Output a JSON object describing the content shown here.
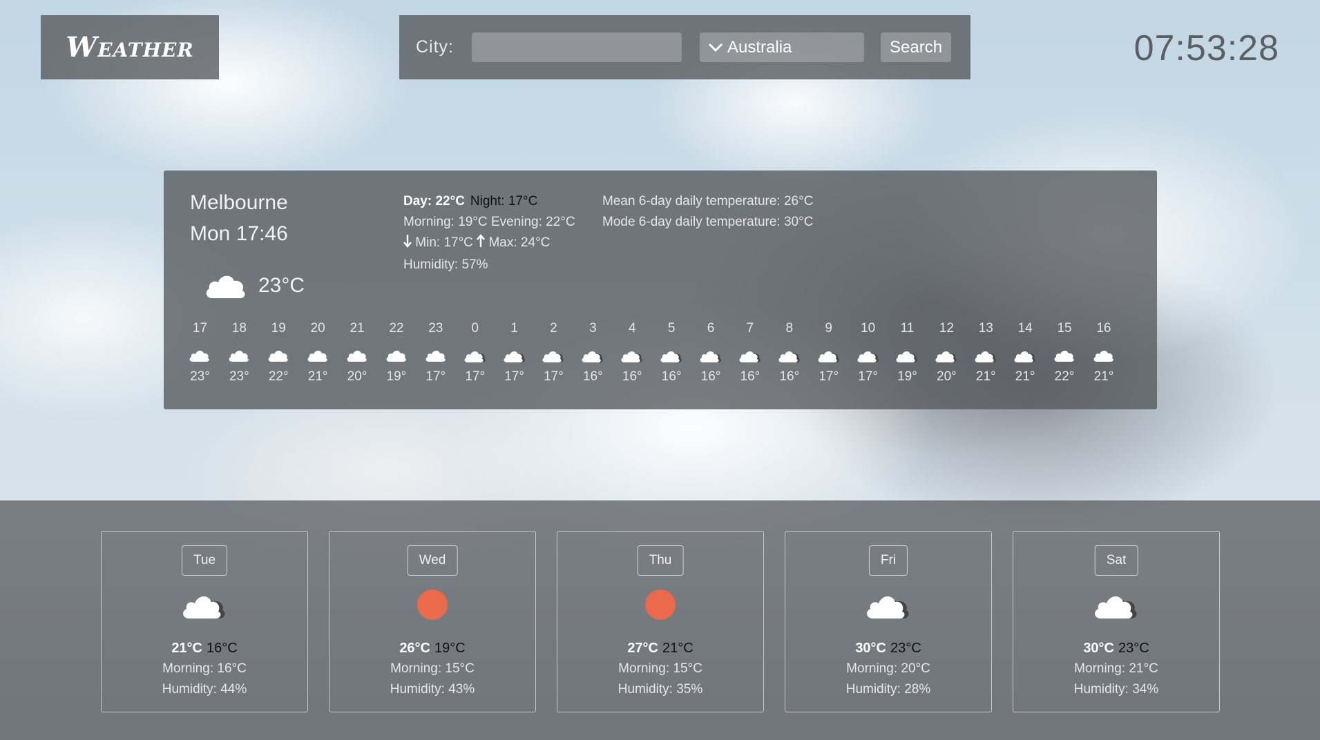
{
  "header": {
    "logo_text": "Weather",
    "city_label": "City:",
    "city_value": "",
    "country_selected": "Australia",
    "search_label": "Search",
    "clock": "07:53:28"
  },
  "current": {
    "city": "Melbourne",
    "time": "Mon 17:46",
    "temp": "23°C",
    "icon": "cloud-icon",
    "day_label": "Day: 22°C",
    "night_label": "Night: 17°C",
    "morning_evening": "Morning: 19°C Evening: 22°C",
    "min_label": "Min: 17°C",
    "max_label": "Max: 24°C",
    "humidity": "Humidity: 57%",
    "mean_temp": "Mean 6-day daily temperature: 26°C",
    "mode_temp": "Mode 6-day daily temperature: 30°C"
  },
  "hourly": [
    {
      "hour": "17",
      "temp": "23°",
      "icon": "cloud-icon"
    },
    {
      "hour": "18",
      "temp": "23°",
      "icon": "cloud-icon"
    },
    {
      "hour": "19",
      "temp": "22°",
      "icon": "cloud-icon"
    },
    {
      "hour": "20",
      "temp": "21°",
      "icon": "cloud-icon"
    },
    {
      "hour": "21",
      "temp": "20°",
      "icon": "cloud-icon"
    },
    {
      "hour": "22",
      "temp": "19°",
      "icon": "cloud-icon"
    },
    {
      "hour": "23",
      "temp": "17°",
      "icon": "cloud-icon"
    },
    {
      "hour": "0",
      "temp": "17°",
      "icon": "broken-clouds-icon"
    },
    {
      "hour": "1",
      "temp": "17°",
      "icon": "broken-clouds-icon"
    },
    {
      "hour": "2",
      "temp": "17°",
      "icon": "broken-clouds-icon"
    },
    {
      "hour": "3",
      "temp": "16°",
      "icon": "broken-clouds-icon"
    },
    {
      "hour": "4",
      "temp": "16°",
      "icon": "broken-clouds-icon"
    },
    {
      "hour": "5",
      "temp": "16°",
      "icon": "broken-clouds-icon"
    },
    {
      "hour": "6",
      "temp": "16°",
      "icon": "broken-clouds-icon"
    },
    {
      "hour": "7",
      "temp": "16°",
      "icon": "broken-clouds-icon"
    },
    {
      "hour": "8",
      "temp": "16°",
      "icon": "broken-clouds-icon"
    },
    {
      "hour": "9",
      "temp": "17°",
      "icon": "broken-clouds-icon"
    },
    {
      "hour": "10",
      "temp": "17°",
      "icon": "broken-clouds-icon"
    },
    {
      "hour": "11",
      "temp": "19°",
      "icon": "broken-clouds-icon"
    },
    {
      "hour": "12",
      "temp": "20°",
      "icon": "broken-clouds-icon"
    },
    {
      "hour": "13",
      "temp": "21°",
      "icon": "broken-clouds-icon"
    },
    {
      "hour": "14",
      "temp": "21°",
      "icon": "broken-clouds-icon"
    },
    {
      "hour": "15",
      "temp": "22°",
      "icon": "cloud-icon"
    },
    {
      "hour": "16",
      "temp": "21°",
      "icon": "cloud-icon"
    }
  ],
  "forecast": [
    {
      "day": "Tue",
      "day_temp": "21°C",
      "night_temp": "16°C",
      "morning": "Morning: 16°C",
      "humidity": "Humidity: 44%",
      "icon": "broken-clouds-icon"
    },
    {
      "day": "Wed",
      "day_temp": "26°C",
      "night_temp": "19°C",
      "morning": "Morning: 15°C",
      "humidity": "Humidity: 43%",
      "icon": "sun-icon"
    },
    {
      "day": "Thu",
      "day_temp": "27°C",
      "night_temp": "21°C",
      "morning": "Morning: 15°C",
      "humidity": "Humidity: 35%",
      "icon": "sun-icon"
    },
    {
      "day": "Fri",
      "day_temp": "30°C",
      "night_temp": "23°C",
      "morning": "Morning: 20°C",
      "humidity": "Humidity: 28%",
      "icon": "broken-clouds-icon"
    },
    {
      "day": "Sat",
      "day_temp": "30°C",
      "night_temp": "23°C",
      "morning": "Morning: 21°C",
      "humidity": "Humidity: 34%",
      "icon": "broken-clouds-icon"
    }
  ],
  "colors": {
    "panel": "#55585c",
    "sun": "#ec6a4c",
    "clock": "#5b5f63"
  }
}
